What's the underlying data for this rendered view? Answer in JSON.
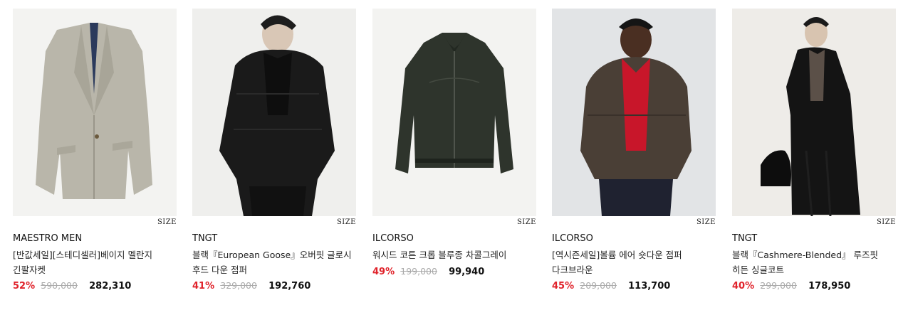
{
  "products": [
    {
      "size_label": "SIZE",
      "brand": "MAESTRO MEN",
      "name": "[반값세일][스테디셀러]베이지 멜란지 긴팔자켓",
      "discount": "52%",
      "original_price": "590,000",
      "price": "282,310"
    },
    {
      "size_label": "SIZE",
      "brand": "TNGT",
      "name": "블랙『European Goose』오버핏 글로시 후드 다운 점퍼",
      "discount": "41%",
      "original_price": "329,000",
      "price": "192,760"
    },
    {
      "size_label": "SIZE",
      "brand": "ILCORSO",
      "name": "워시드 코튼 크롭 블루종 차콜그레이",
      "discount": "49%",
      "original_price": "199,000",
      "price": "99,940"
    },
    {
      "size_label": "SIZE",
      "brand": "ILCORSO",
      "name": "[역시즌세일]볼륨 에어 숏다운 점퍼 다크브라운",
      "discount": "45%",
      "original_price": "209,000",
      "price": "113,700"
    },
    {
      "size_label": "SIZE",
      "brand": "TNGT",
      "name": "블랙『Cashmere-Blended』 루즈핏 히든 싱글코트",
      "discount": "40%",
      "original_price": "299,000",
      "price": "178,950"
    }
  ],
  "colors": {
    "discount": "#e0232b",
    "original_price": "#aaaaaa",
    "text": "#111111"
  }
}
